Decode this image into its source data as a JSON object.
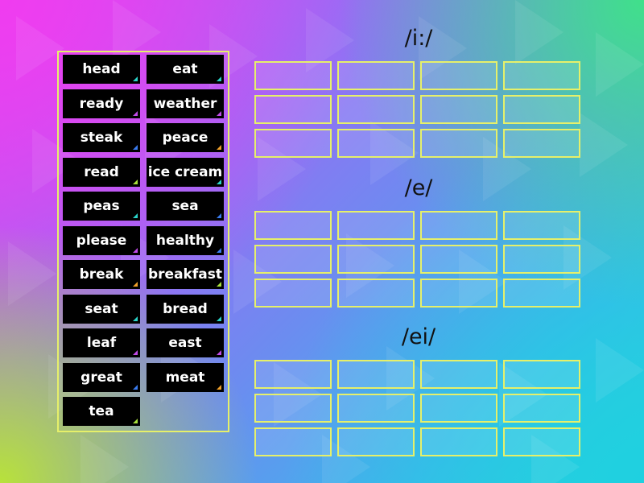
{
  "word_bank": [
    {
      "word": "head",
      "corner_color": "#2ad3c8"
    },
    {
      "word": "eat",
      "corner_color": "#2ad3c8"
    },
    {
      "word": "ready",
      "corner_color": "#c04ae8"
    },
    {
      "word": "weather",
      "corner_color": "#c04ae8"
    },
    {
      "word": "steak",
      "corner_color": "#3a7cf0"
    },
    {
      "word": "peace",
      "corner_color": "#f0a02a"
    },
    {
      "word": "read",
      "corner_color": "#a8e03a"
    },
    {
      "word": "ice cream",
      "corner_color": "#2ad3c8"
    },
    {
      "word": "peas",
      "corner_color": "#2ad3c8"
    },
    {
      "word": "sea",
      "corner_color": "#3a7cf0"
    },
    {
      "word": "please",
      "corner_color": "#c04ae8"
    },
    {
      "word": "healthy",
      "corner_color": "#3a7cf0"
    },
    {
      "word": "break",
      "corner_color": "#f0a02a"
    },
    {
      "word": "breakfast",
      "corner_color": "#a8e03a"
    },
    {
      "word": "seat",
      "corner_color": "#2ad3c8"
    },
    {
      "word": "bread",
      "corner_color": "#2ad3c8"
    },
    {
      "word": "leaf",
      "corner_color": "#c04ae8"
    },
    {
      "word": "east",
      "corner_color": "#c04ae8"
    },
    {
      "word": "great",
      "corner_color": "#3a7cf0"
    },
    {
      "word": "meat",
      "corner_color": "#f0a02a"
    },
    {
      "word": "tea",
      "corner_color": "#a8e03a"
    }
  ],
  "groups": [
    {
      "heading": "/i:/"
    },
    {
      "heading": "/e/"
    },
    {
      "heading": "/ei/"
    }
  ],
  "slots_per_group": 12,
  "colors": {
    "tile_background": "#000000",
    "outline": "#e6f06a"
  }
}
